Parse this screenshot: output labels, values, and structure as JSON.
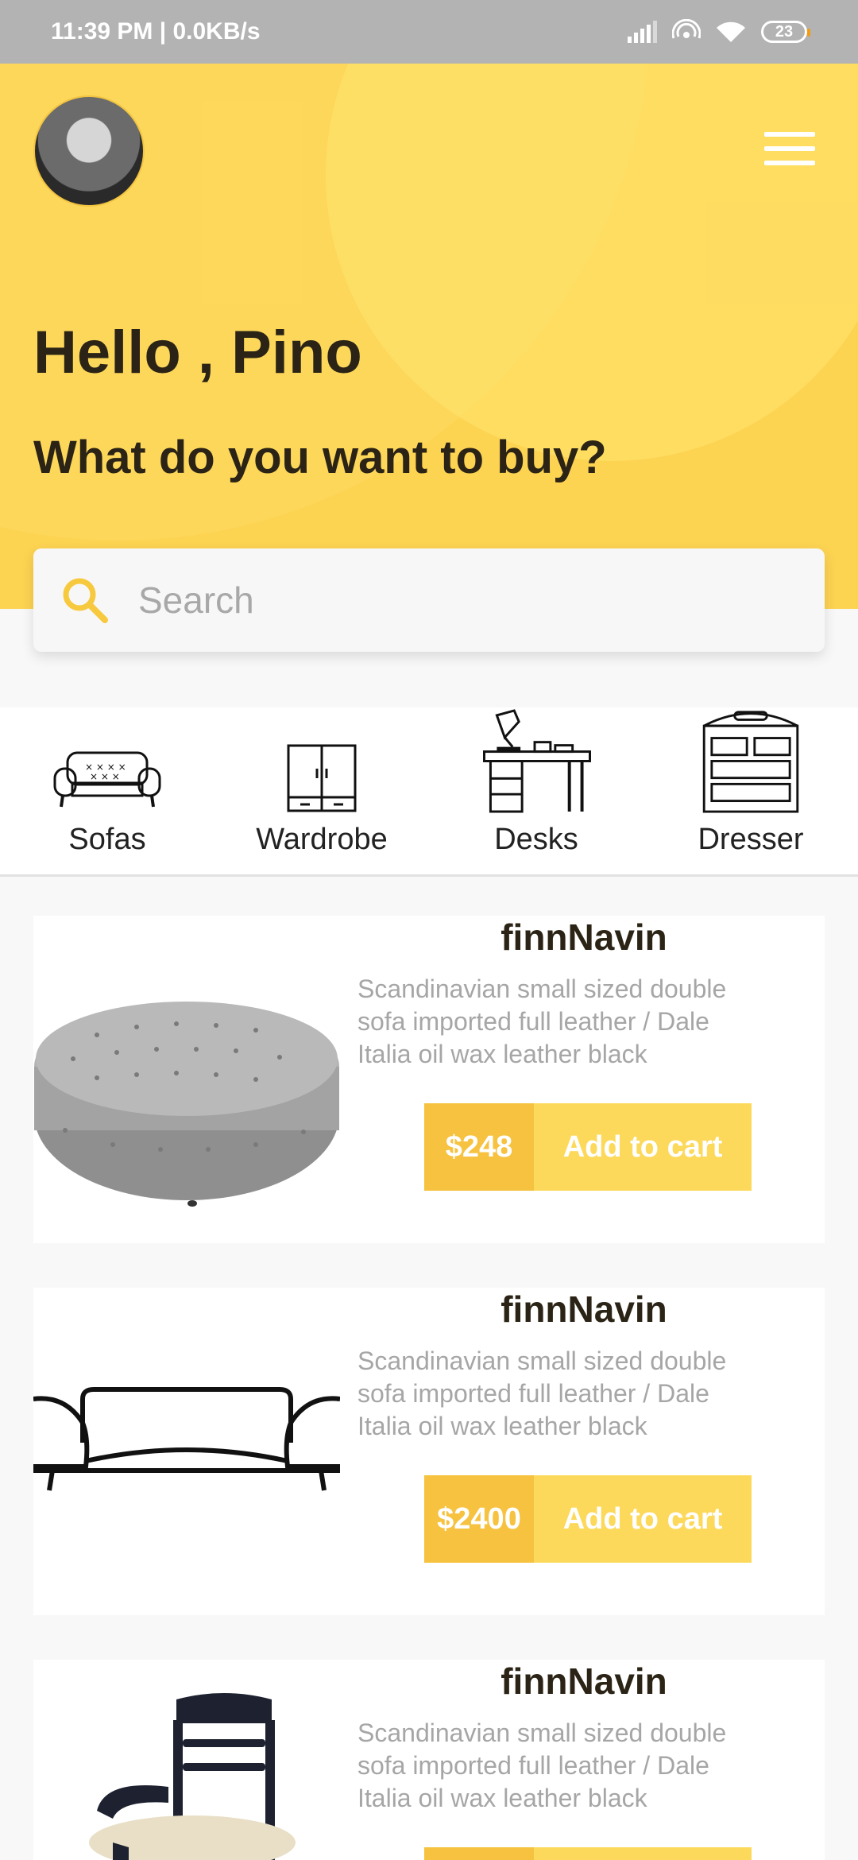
{
  "status_bar": {
    "time_speed": "11:39 PM | 0.0KB/s",
    "battery": "23"
  },
  "header": {
    "greeting": "Hello , Pino",
    "prompt": "What do you want to buy?"
  },
  "search": {
    "placeholder": "Search"
  },
  "categories": [
    {
      "label": "Sofas",
      "icon": "sofa-icon"
    },
    {
      "label": "Wardrobe",
      "icon": "wardrobe-icon"
    },
    {
      "label": "Desks",
      "icon": "desk-icon"
    },
    {
      "label": "Dresser",
      "icon": "dresser-icon"
    }
  ],
  "products": [
    {
      "title": "finnNavin",
      "description": "Scandinavian small sized double sofa imported full leather / Dale Italia oil wax leather black",
      "price": "$248",
      "cta": "Add to cart",
      "image": "tufted-ottoman"
    },
    {
      "title": "finnNavin",
      "description": "Scandinavian small sized double sofa imported full leather / Dale Italia oil wax leather black",
      "price": "$2400",
      "cta": "Add to cart",
      "image": "sofa-outline"
    },
    {
      "title": "finnNavin",
      "description": "Scandinavian small sized double sofa imported full leather / Dale Italia oil wax leather black",
      "price": "",
      "cta": "",
      "image": "carved-chair"
    }
  ],
  "colors": {
    "header_yellow": "#fdd352",
    "price_yellow": "#f6c23f",
    "cart_yellow": "#fcd95b",
    "search_icon": "#f7c93e"
  }
}
